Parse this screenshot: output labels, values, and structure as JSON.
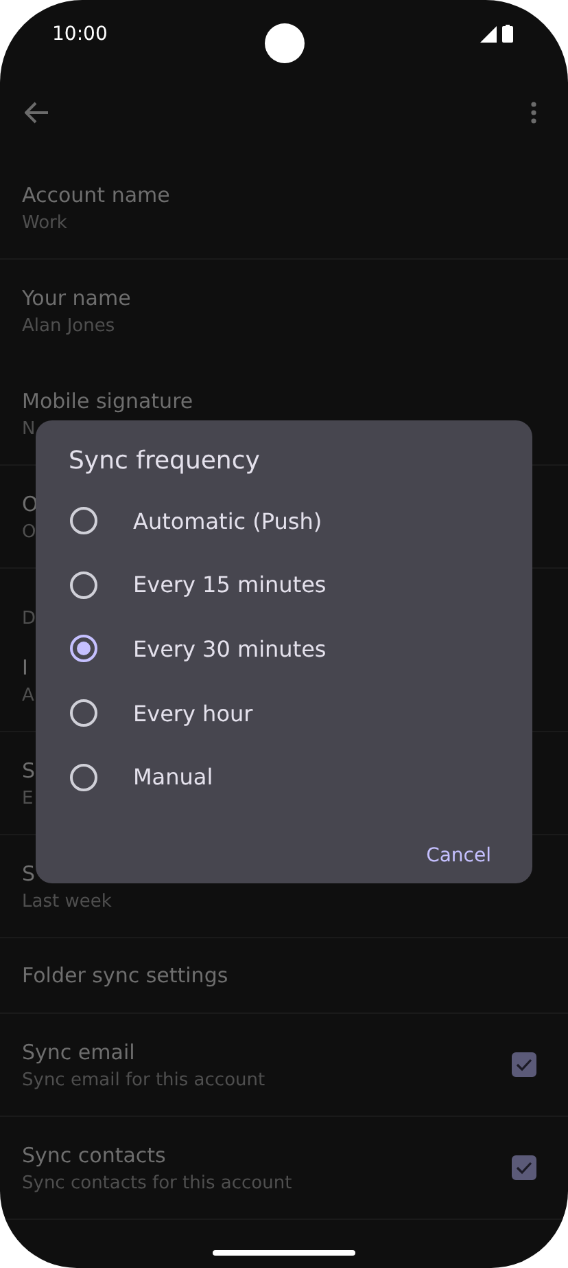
{
  "status_bar": {
    "time": "10:00"
  },
  "rows": [
    {
      "kind": "text",
      "title": "Account name",
      "subtitle": "Work"
    },
    {
      "kind": "text",
      "title": "Your name",
      "subtitle": "Alan Jones"
    },
    {
      "kind": "text",
      "title": "Mobile signature",
      "subtitle": "N"
    },
    {
      "kind": "text",
      "title": "O",
      "subtitle": "O"
    },
    {
      "kind": "header",
      "title": "D"
    },
    {
      "kind": "text",
      "title": "I",
      "subtitle": "A"
    },
    {
      "kind": "text",
      "title": "S",
      "subtitle": "E"
    },
    {
      "kind": "text",
      "title": "S",
      "subtitle": "Last week"
    },
    {
      "kind": "single",
      "title": "Folder sync settings"
    },
    {
      "kind": "checkbox",
      "title": "Sync email",
      "subtitle": "Sync email for this account",
      "checked": true
    },
    {
      "kind": "checkbox",
      "title": "Sync contacts",
      "subtitle": "Sync contacts for this account",
      "checked": true
    }
  ],
  "dialog": {
    "title": "Sync frequency",
    "options": [
      {
        "label": "Automatic (Push)",
        "selected": false
      },
      {
        "label": "Every 15 minutes",
        "selected": false
      },
      {
        "label": "Every 30 minutes",
        "selected": true
      },
      {
        "label": "Every hour",
        "selected": false
      },
      {
        "label": "Manual",
        "selected": false
      }
    ],
    "button": "Cancel"
  }
}
